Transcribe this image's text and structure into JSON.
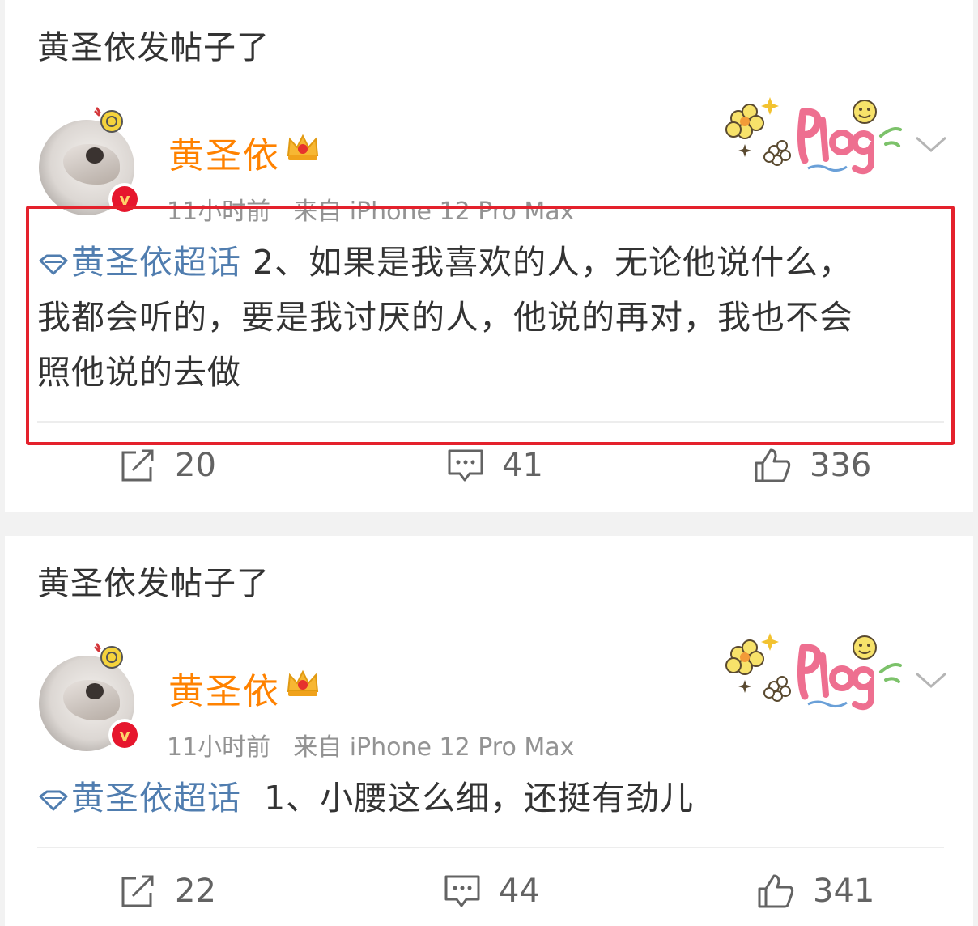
{
  "posts": [
    {
      "header": "黄圣依发帖子了",
      "username": "黄圣依",
      "time": "11小时前",
      "source": "来自 iPhone 12 Pro Max",
      "topic": "黄圣依超话",
      "content_line1": " 2、如果是我喜欢的人，无论他说什么，",
      "content_line2": "我都会听的，要是我讨厌的人，他说的再对，我也不会",
      "content_line3": "照他说的去做",
      "reposts": "20",
      "comments": "41",
      "likes": "336"
    },
    {
      "header": "黄圣依发帖子了",
      "username": "黄圣依",
      "time": "11小时前",
      "source": "来自 iPhone 12 Pro Max",
      "topic": "黄圣依超话",
      "content_line1": "  1、小腰这么细，还挺有劲儿",
      "reposts": "22",
      "comments": "44",
      "likes": "341"
    }
  ],
  "colors": {
    "username": "#ff8200",
    "topic": "#507daf",
    "highlight_box": "#e4212c",
    "verified_badge": "#e6162d"
  },
  "icons": [
    "verified-badge-icon",
    "crown-icon",
    "plog-sticker",
    "chevron-down-icon",
    "diamond-topic-icon",
    "repost-icon",
    "comment-icon",
    "like-icon"
  ]
}
